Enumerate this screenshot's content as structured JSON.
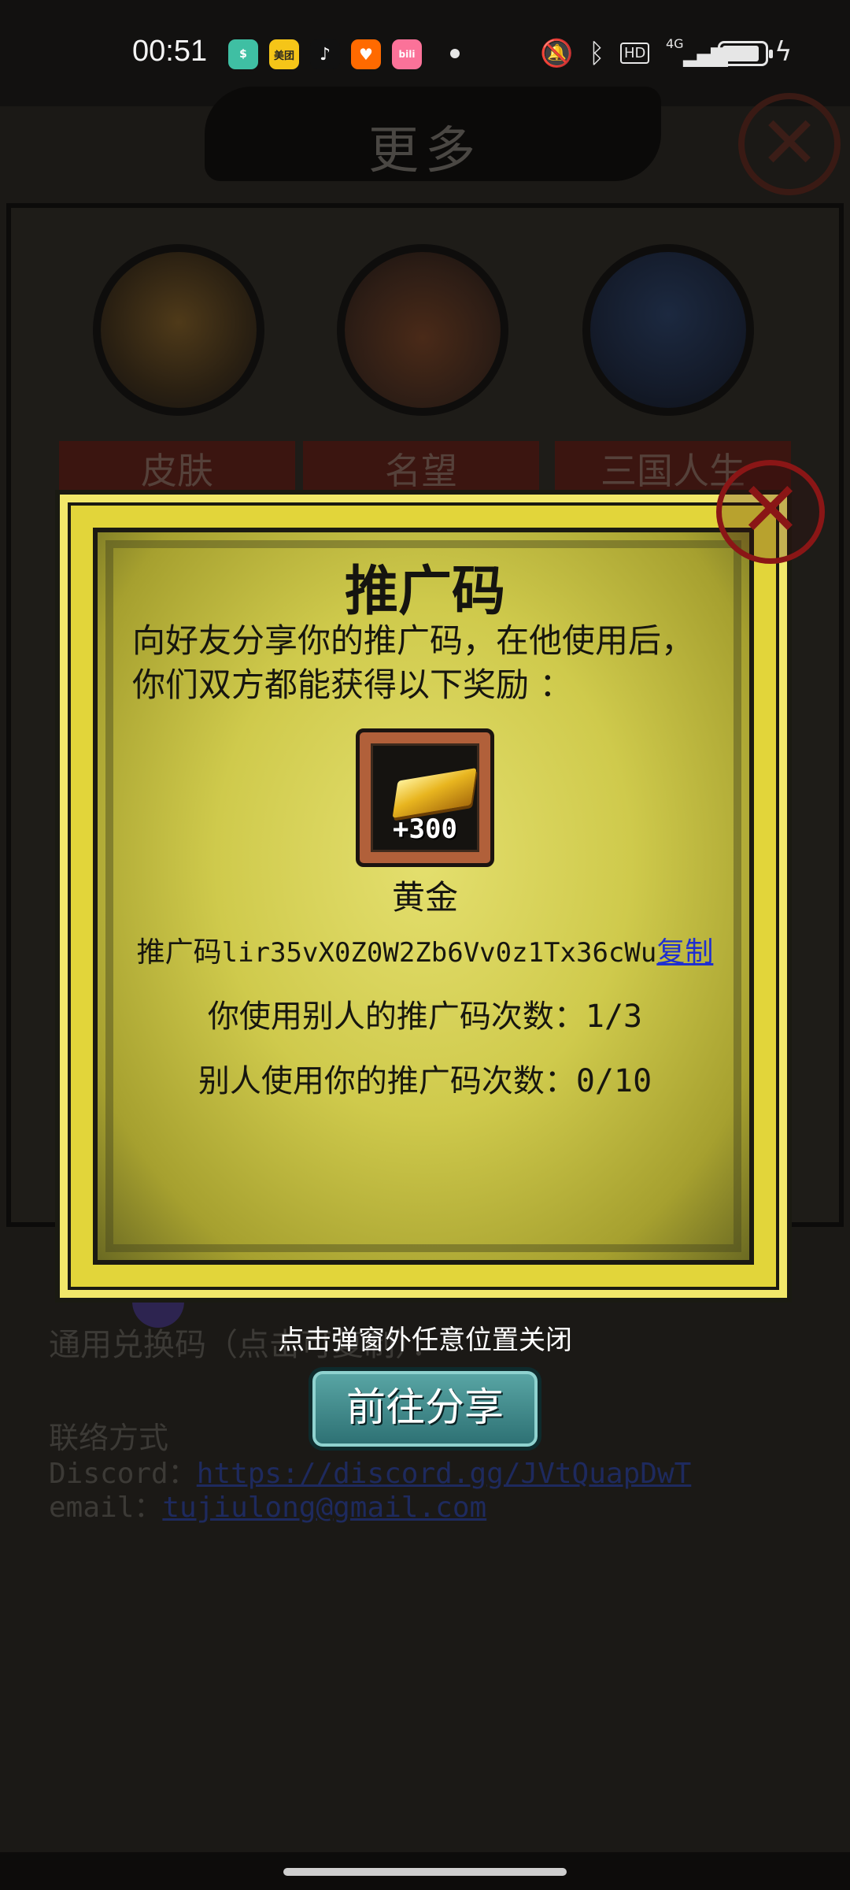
{
  "status_bar": {
    "time": "00:51",
    "apps": [
      {
        "name": "wallet-app-icon",
        "label": "$",
        "color": "#3fbfa3"
      },
      {
        "name": "meituan-app-icon",
        "label": "美团",
        "color": "#f5c518"
      },
      {
        "name": "tiktok-app-icon",
        "label": "♪",
        "color": "#111111"
      },
      {
        "name": "taobao-app-icon",
        "label": "♥",
        "color": "#ff6a00"
      },
      {
        "name": "bilibili-app-icon",
        "label": "bili",
        "color": "#fb7299"
      }
    ],
    "network_label": "4G",
    "hd_label": "HD"
  },
  "background_page": {
    "title": "更多",
    "tabs": [
      "皮肤",
      "名望",
      "三国人生"
    ],
    "redeem_label": "通用兑换码（点击可复制）：",
    "contact_label": "联络方式",
    "discord_label": "Discord：",
    "discord_link": "https://discord.gg/JVtQuapDwT",
    "email_label": "email：",
    "email_link": "tujiulong@gmail.com"
  },
  "modal": {
    "title": "推广码",
    "description_line1": "向好友分享你的推广码，在他使用后，",
    "description_line2": "你们双方都能获得以下奖励 ：",
    "reward": {
      "amount": "+300",
      "name": "黄金",
      "icon": "gold-bar-icon"
    },
    "code_label": "推广码",
    "code_value": "lir35vX0Z0W2Zb6Vv0z1Tx36cWu",
    "copy_label": "复制",
    "used_others_label": "你使用别人的推广码次数：",
    "used_others_value": "1/3",
    "others_used_label": "别人使用你的推广码次数：",
    "others_used_value": "0/10"
  },
  "hint": "点击弹窗外任意位置关闭",
  "share_button": "前往分享",
  "colors": {
    "modal_frame": "#e2d53a",
    "copy_link": "#1f2fd0",
    "share_button": "#3d8a8b",
    "close_icon": "#8a1616"
  }
}
